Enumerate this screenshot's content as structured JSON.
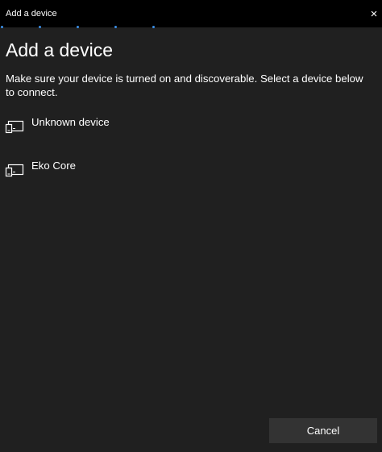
{
  "window": {
    "title": "Add a device",
    "close_symbol": "×"
  },
  "page": {
    "heading": "Add a device",
    "instructions": "Make sure your device is turned on and discoverable. Select a device below to connect."
  },
  "devices": [
    {
      "label": "Unknown device",
      "icon": "device-icon"
    },
    {
      "label": "Eko Core",
      "icon": "device-icon"
    }
  ],
  "footer": {
    "cancel_label": "Cancel"
  },
  "colors": {
    "background": "#202020",
    "titlebar": "#000000",
    "accent": "#3a8ee6",
    "button": "#333333"
  }
}
